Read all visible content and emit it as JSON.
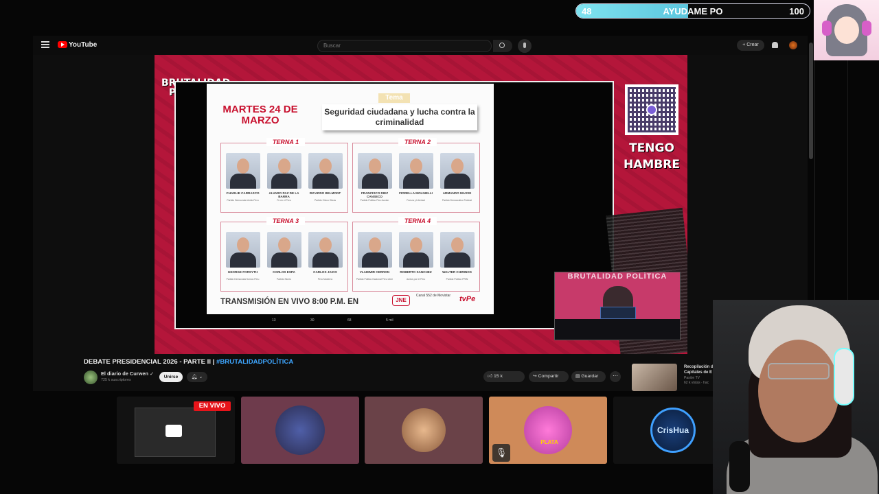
{
  "goal": {
    "current": "48",
    "label": "AYUDAME PO",
    "target": "100",
    "progress": 0.48
  },
  "youtube": {
    "brand": "YouTube",
    "search_placeholder": "Buscar",
    "create_label": "+ Crear"
  },
  "video": {
    "brand_line1": "BRUTALIDAD",
    "brand_line2": "POLÍTICA",
    "card": {
      "date": "MARTES 24 DE MARZO",
      "tema_label": "Tema",
      "tema": "Seguridad ciudadana y lucha contra la criminalidad",
      "ternas": [
        {
          "label": "TERNA 1",
          "candidates": [
            {
              "name": "CHARLIE CARRASCO",
              "party": "Partido Democrata Unido Peru"
            },
            {
              "name": "ALVARO PAZ DE LA BARRA",
              "party": "Fe en el Peru"
            },
            {
              "name": "RICARDO BELMONT",
              "party": "Partido Civico Obras"
            }
          ]
        },
        {
          "label": "TERNA 2",
          "candidates": [
            {
              "name": "FRANCISCO DIEZ CANSECO",
              "party": "Partido Politico Peru Accion"
            },
            {
              "name": "FIORELLA MOLINELLI",
              "party": "Fuerza y Libertad"
            },
            {
              "name": "ARMANDO MASSE",
              "party": "Partido Democratico Federal"
            }
          ]
        },
        {
          "label": "TERNA 3",
          "candidates": [
            {
              "name": "GEORGE FORSYTH",
              "party": "Partido Democrata Somos Peru"
            },
            {
              "name": "CARLOS ESPA",
              "party": "Partido Sicreo"
            },
            {
              "name": "CARLOS JAICO",
              "party": "Peru Moderno"
            }
          ]
        },
        {
          "label": "TERNA 4",
          "candidates": [
            {
              "name": "VLADIMIR CERRON",
              "party": "Partido Politico Nacional Peru Libre"
            },
            {
              "name": "ROBERTO SANCHEZ",
              "party": "Juntos por el Peru"
            },
            {
              "name": "WALTER CHIRINOS",
              "party": "Partido Politico PRIN"
            }
          ]
        }
      ],
      "transmission": "TRANSMISIÓN EN VIVO 8:00 P.M. EN",
      "jne": "JNE",
      "canal": "Canal 552 de Movistar",
      "tvpe": "tvPe",
      "stats": {
        "comments": "13",
        "reposts": "30",
        "likes": "68",
        "views": "5 mil"
      }
    },
    "side_text_1": "TENGO",
    "side_text_2": "HAMBRE",
    "pip_text": "BRUTALIDAD POLÍTICA"
  },
  "video_info": {
    "title": "DEBATE PRESIDENCIAL 2026 - PARTE II | ",
    "hashtag": "#BRUTALIDADPOLÍTICA",
    "channel": "El diario de Curwen ✓",
    "subscribers": "725 k suscriptores",
    "join": "Unirse",
    "likes": "15 k",
    "share": "Compartir",
    "save": "Guardar",
    "more": "⋯",
    "rec_title": "Recopilación de Capitales de E",
    "rec_channel": "Pasión TV",
    "rec_meta": "62 k vistas · hac"
  },
  "tiles": {
    "live_label": "EN VIVO",
    "tile4_caption": "PLATA",
    "tile5_name": "CrisHua"
  },
  "colors": {
    "accent_red": "#c8102e",
    "brand_red": "#b4163a",
    "link_blue": "#3ea6ff"
  }
}
